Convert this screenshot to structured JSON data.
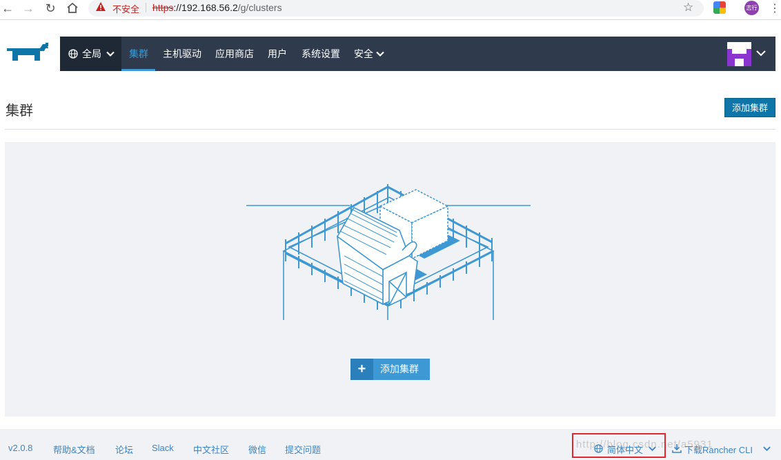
{
  "browser": {
    "security_label": "不安全",
    "url_scheme": "https",
    "url_host": "://192.168.56.2",
    "url_path": "/g/clusters",
    "profile_label": "志行"
  },
  "header": {
    "scope_label": "全局",
    "nav": {
      "clusters": "集群",
      "node_drivers": "主机驱动",
      "catalogs": "应用商店",
      "users": "用户",
      "settings": "系统设置",
      "security": "安全"
    }
  },
  "page": {
    "title": "集群",
    "add_button": "添加集群",
    "empty_add_button": "添加集群"
  },
  "footer": {
    "version": "v2.0.8",
    "help": "帮助&文档",
    "forum": "论坛",
    "slack": "Slack",
    "community": "中文社区",
    "wechat": "微信",
    "issue": "提交问题",
    "language": "简体中文",
    "cli": "下载Rancher CLI",
    "watermark": "http://blog.csdn.net/a5931"
  },
  "colors": {
    "accent": "#3d98d3",
    "navbar": "#2f3b4c",
    "highlight": "#e0262e"
  }
}
